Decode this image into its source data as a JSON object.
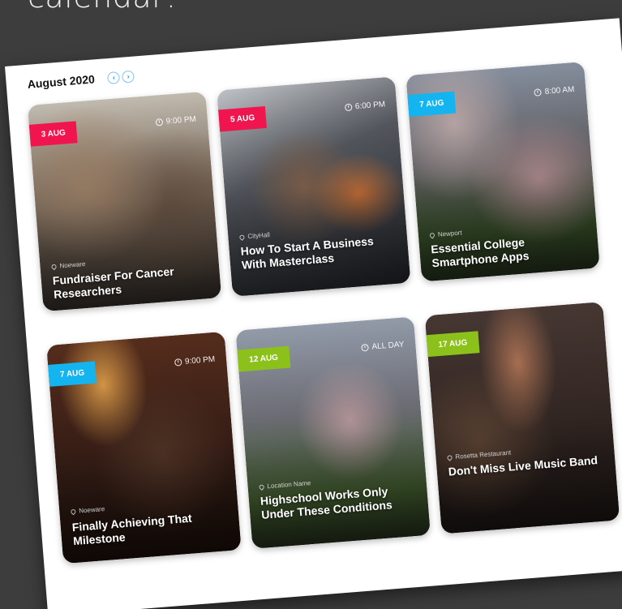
{
  "caption": "calendar!",
  "calendar": {
    "month_title": "August 2020",
    "prev_icon": "‹",
    "next_icon": "›"
  },
  "colors": {
    "badge_red": "#f0154f",
    "badge_blue": "#14b4f0",
    "badge_green": "#8cc11c",
    "nav_accent": "#2a9be0"
  },
  "events": [
    {
      "date": "3 AUG",
      "time": "9:00 PM",
      "venue": "Noeware",
      "title": "Fundraiser For Cancer Researchers",
      "badge_color": "#f0154f"
    },
    {
      "date": "5 AUG",
      "time": "6:00 PM",
      "venue": "CityHall",
      "title": "How To Start A Business With Masterclass",
      "badge_color": "#f0154f"
    },
    {
      "date": "7 AUG",
      "time": "8:00 AM",
      "venue": "Newport",
      "title": "Essential College Smartphone Apps",
      "badge_color": "#14b4f0"
    },
    {
      "date": "7 AUG",
      "time": "9:00 PM",
      "venue": "Noeware",
      "title": "Finally Achieving That Milestone",
      "badge_color": "#14b4f0"
    },
    {
      "date": "12 AUG",
      "time": "ALL DAY",
      "venue": "Location Name",
      "title": "Highschool Works Only Under These Conditions",
      "badge_color": "#8cc11c"
    },
    {
      "date": "17 AUG",
      "time": "",
      "venue": "Rosetta Restaurant",
      "title": "Don't Miss Live Music Band",
      "badge_color": "#8cc11c"
    }
  ]
}
